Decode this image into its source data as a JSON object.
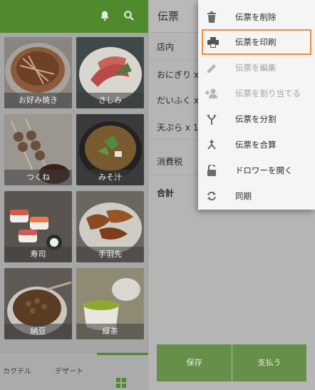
{
  "topbar": {
    "bell_icon": "bell-icon",
    "search_icon": "search-icon"
  },
  "menu_items": [
    {
      "label": "伝票を削除",
      "icon": "trash-icon",
      "state": "normal"
    },
    {
      "label": "伝票を印刷",
      "icon": "printer-icon",
      "state": "selected"
    },
    {
      "label": "伝票を編集",
      "icon": "pencil-icon",
      "state": "disabled"
    },
    {
      "label": "伝票を割り当てる",
      "icon": "person-add-icon",
      "state": "disabled"
    },
    {
      "label": "伝票を分割",
      "icon": "split-icon",
      "state": "normal"
    },
    {
      "label": "伝票を合算",
      "icon": "merge-icon",
      "state": "normal"
    },
    {
      "label": "ドロワーを開く",
      "icon": "unlock-icon",
      "state": "normal"
    },
    {
      "label": "同期",
      "icon": "sync-icon",
      "state": "normal"
    }
  ],
  "products": [
    {
      "label": "お好み焼き"
    },
    {
      "label": "さしみ"
    },
    {
      "label": "つくね"
    },
    {
      "label": "みそ汁"
    },
    {
      "label": "寿司"
    },
    {
      "label": "手羽先"
    },
    {
      "label": "納豆"
    },
    {
      "label": "緑茶"
    }
  ],
  "bottom_tabs": [
    {
      "label": "カクテル"
    },
    {
      "label": "デザート"
    }
  ],
  "ticket": {
    "title": "伝票",
    "dine_type": "店内",
    "items": [
      {
        "name": "おにぎり x"
      },
      {
        "name": "だいふく x"
      },
      {
        "name": "天ぷら x 1"
      }
    ],
    "tax_label": "消費税",
    "total_label": "合計"
  },
  "actions": {
    "save_label": "保存",
    "pay_label": "支払う"
  },
  "colors": {
    "accent": "#4f8a2c",
    "highlight": "#ef8a3a",
    "button": "#668f4a"
  }
}
